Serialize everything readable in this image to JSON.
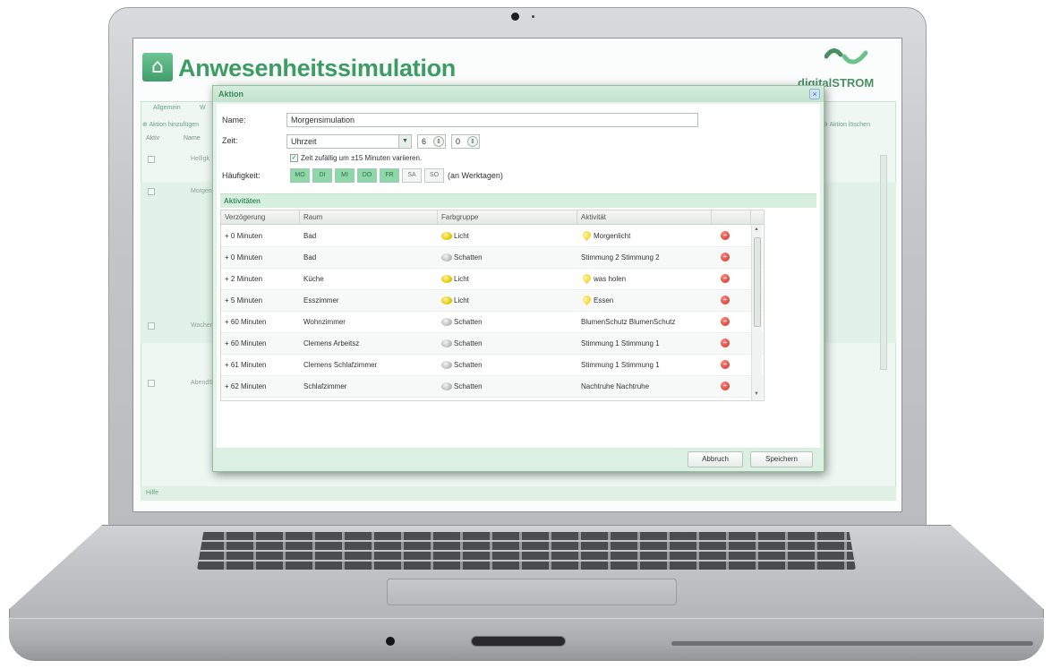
{
  "app": {
    "title": "Anwesenheitssimulation",
    "logo_text": "digitalSTROM",
    "accent_color": "#3b9d64"
  },
  "background": {
    "tabs": [
      "Allgemein",
      "W"
    ],
    "toolbar_left": "Aktion hinzufügen",
    "toolbar_right": "Aktion löschen",
    "columns": [
      "Aktiv",
      "Name"
    ],
    "rows": [
      "Helligk",
      "Morgen",
      "Wochen",
      "AbendS"
    ],
    "footer": "Hilfe"
  },
  "dialog": {
    "title": "Aktion",
    "name_label": "Name:",
    "name_value": "Morgensimulation",
    "time_label": "Zeit:",
    "time_mode": "Uhrzeit",
    "hour": "6",
    "minute": "0",
    "random_label": "Zeit zufällig um ±15 Minuten variieren.",
    "frequency_label": "Häufigkeit:",
    "days": [
      {
        "label": "MO",
        "active": true
      },
      {
        "label": "DI",
        "active": true
      },
      {
        "label": "MI",
        "active": true
      },
      {
        "label": "DO",
        "active": true
      },
      {
        "label": "FR",
        "active": true
      },
      {
        "label": "SA",
        "active": false
      },
      {
        "label": "SO",
        "active": false
      }
    ],
    "days_note": "(an Werktagen)",
    "activities_title": "Aktivitäten",
    "columns": [
      "Verzögerung",
      "Raum",
      "Farbgruppe",
      "Aktivität"
    ],
    "rows": [
      {
        "delay": "+ 0 Minuten",
        "room": "Bad",
        "group": "Licht",
        "group_icon": "light-bulb-icon",
        "activity": "Morgenlicht",
        "scene_icon": true
      },
      {
        "delay": "+ 0 Minuten",
        "room": "Bad",
        "group": "Schatten",
        "group_icon": "shade-icon",
        "activity": "Stimmung 2 Stimmung 2",
        "scene_icon": false
      },
      {
        "delay": "+ 2 Minuten",
        "room": "Küche",
        "group": "Licht",
        "group_icon": "light-bulb-icon",
        "activity": "was holen",
        "scene_icon": true
      },
      {
        "delay": "+ 5 Minuten",
        "room": "Esszimmer",
        "group": "Licht",
        "group_icon": "light-bulb-icon",
        "activity": "Essen",
        "scene_icon": true
      },
      {
        "delay": "+ 60 Minuten",
        "room": "Wohnzimmer",
        "group": "Schatten",
        "group_icon": "shade-icon",
        "activity": "BlumenSchutz BlumenSchutz",
        "scene_icon": false
      },
      {
        "delay": "+ 60 Minuten",
        "room": "Clemens Arbeitsz",
        "group": "Schatten",
        "group_icon": "shade-icon",
        "activity": "Stimmung 1 Stimmung 1",
        "scene_icon": false
      },
      {
        "delay": "+ 61 Minuten",
        "room": "Clemens Schlafzimmer",
        "group": "Schatten",
        "group_icon": "shade-icon",
        "activity": "Stimmung 1 Stimmung 1",
        "scene_icon": false
      },
      {
        "delay": "+ 62 Minuten",
        "room": "Schlafzimmer",
        "group": "Schatten",
        "group_icon": "shade-icon",
        "activity": "Nachtruhe Nachtruhe",
        "scene_icon": false
      }
    ],
    "cancel_label": "Abbruch",
    "save_label": "Speichern"
  }
}
